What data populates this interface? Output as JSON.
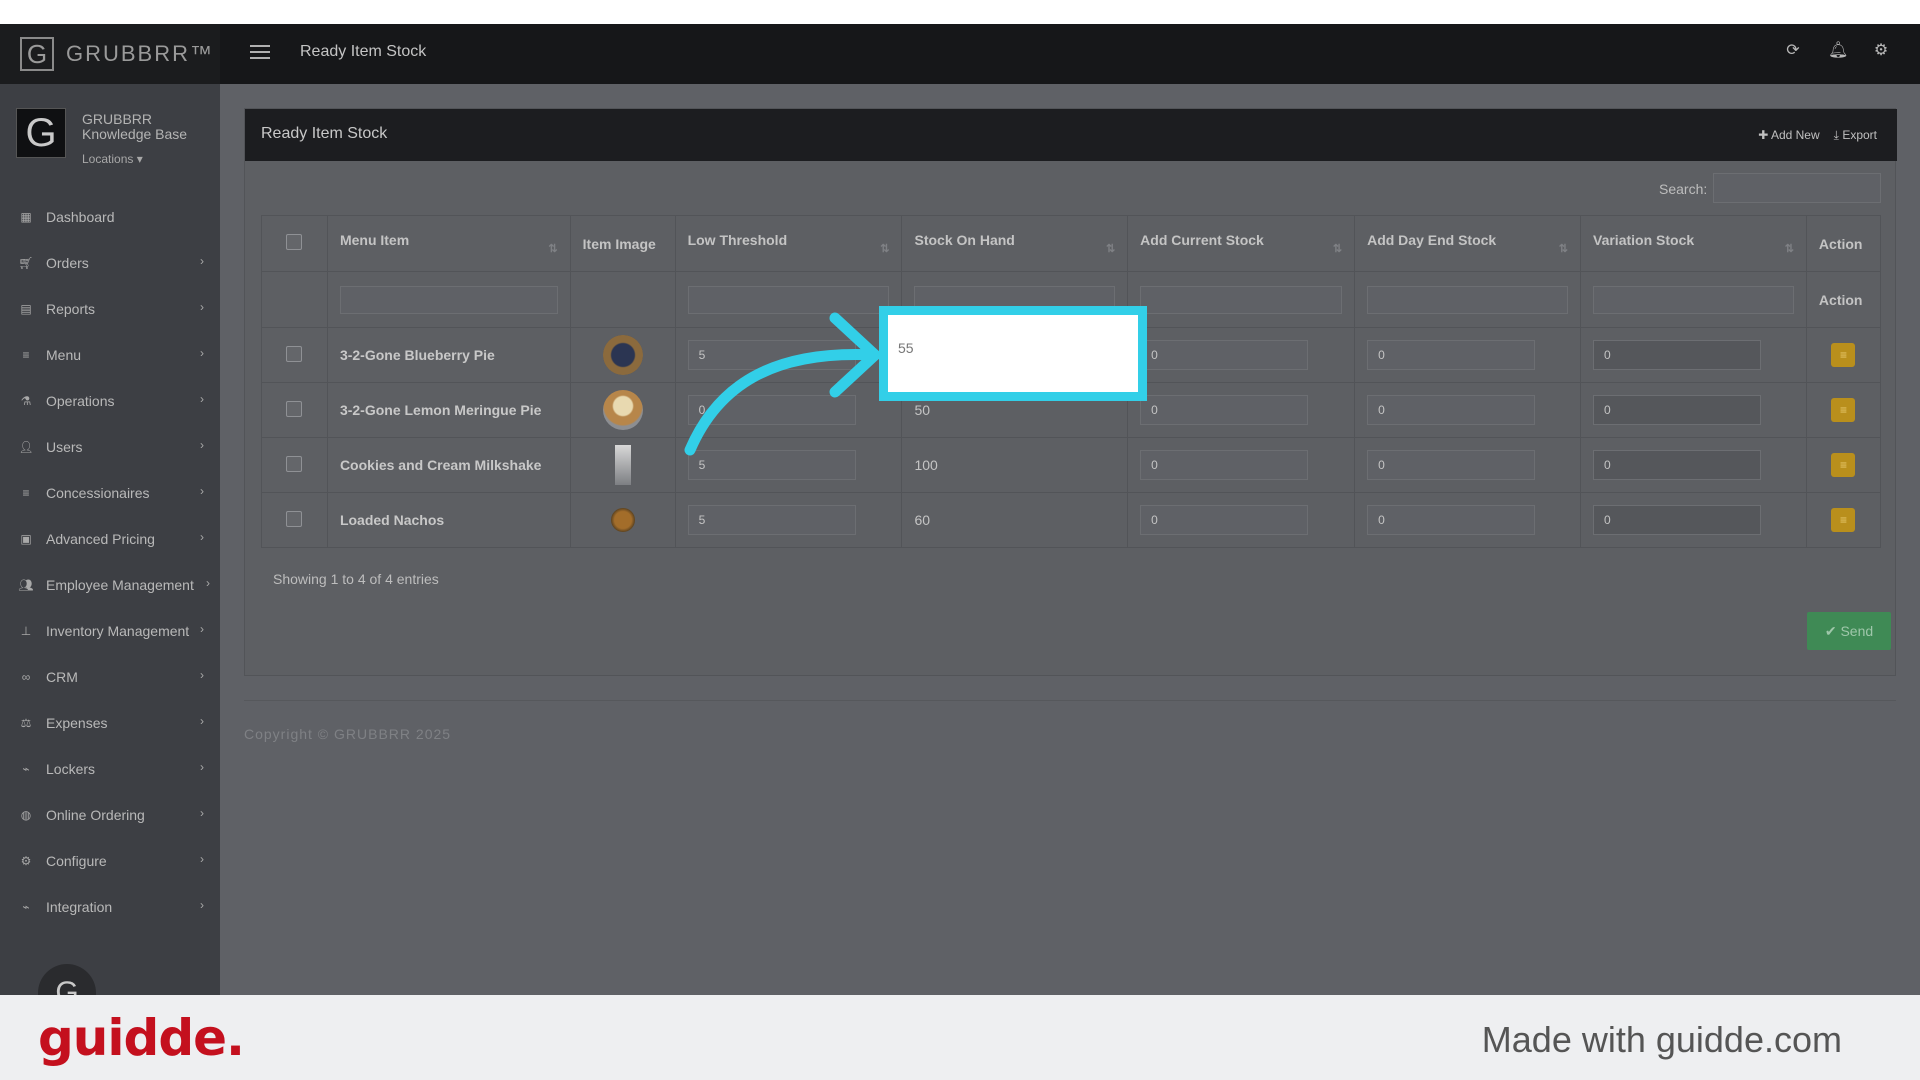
{
  "header": {
    "brand": "GRUBBRR™",
    "page_title": "Ready Item Stock"
  },
  "profile": {
    "name": "GRUBBRR Knowledge Base",
    "locations": "Locations"
  },
  "sidebar": {
    "items": [
      {
        "label": "Dashboard",
        "icon": "dashboard-icon"
      },
      {
        "label": "Orders",
        "icon": "cart-icon"
      },
      {
        "label": "Reports",
        "icon": "report-icon"
      },
      {
        "label": "Menu",
        "icon": "menu-list-icon"
      },
      {
        "label": "Operations",
        "icon": "flask-icon"
      },
      {
        "label": "Users",
        "icon": "user-plus-icon"
      },
      {
        "label": "Concessionaires",
        "icon": "list-icon"
      },
      {
        "label": "Advanced Pricing",
        "icon": "money-icon"
      },
      {
        "label": "Employee Management",
        "icon": "users-icon"
      },
      {
        "label": "Inventory Management",
        "icon": "sitemap-icon"
      },
      {
        "label": "CRM",
        "icon": "link-icon"
      },
      {
        "label": "Expenses",
        "icon": "balance-icon"
      },
      {
        "label": "Lockers",
        "icon": "plug-icon"
      },
      {
        "label": "Online Ordering",
        "icon": "globe-icon"
      },
      {
        "label": "Configure",
        "icon": "gear-icon"
      },
      {
        "label": "Integration",
        "icon": "plug-icon"
      }
    ]
  },
  "panel": {
    "title": "Ready Item Stock",
    "add_new": "Add New",
    "export": "Export",
    "search_label": "Search:",
    "showing": "Showing 1 to 4 of 4 entries",
    "send": "Send"
  },
  "table": {
    "headers": [
      "Menu Item",
      "Item Image",
      "Low Threshold",
      "Stock On Hand",
      "Add Current Stock",
      "Add Day End Stock",
      "Variation Stock",
      "Action"
    ],
    "filter_action_label": "Action",
    "rows": [
      {
        "name": "3-2-Gone Blueberry Pie",
        "low": "5",
        "stock": "55",
        "current": "0",
        "day_end": "0",
        "variation": "0"
      },
      {
        "name": "3-2-Gone Lemon Meringue Pie",
        "low": "0",
        "stock": "50",
        "current": "0",
        "day_end": "0",
        "variation": "0"
      },
      {
        "name": "Cookies and Cream Milkshake",
        "low": "5",
        "stock": "100",
        "current": "0",
        "day_end": "0",
        "variation": "0"
      },
      {
        "name": "Loaded Nachos",
        "low": "5",
        "stock": "60",
        "current": "0",
        "day_end": "0",
        "variation": "0"
      }
    ]
  },
  "highlight": {
    "value": "55",
    "color": "#32cfe8"
  },
  "copyright": "Copyright © GRUBBRR 2025",
  "footer": {
    "logo": "guidde.",
    "made_with": "Made with guidde.com"
  }
}
